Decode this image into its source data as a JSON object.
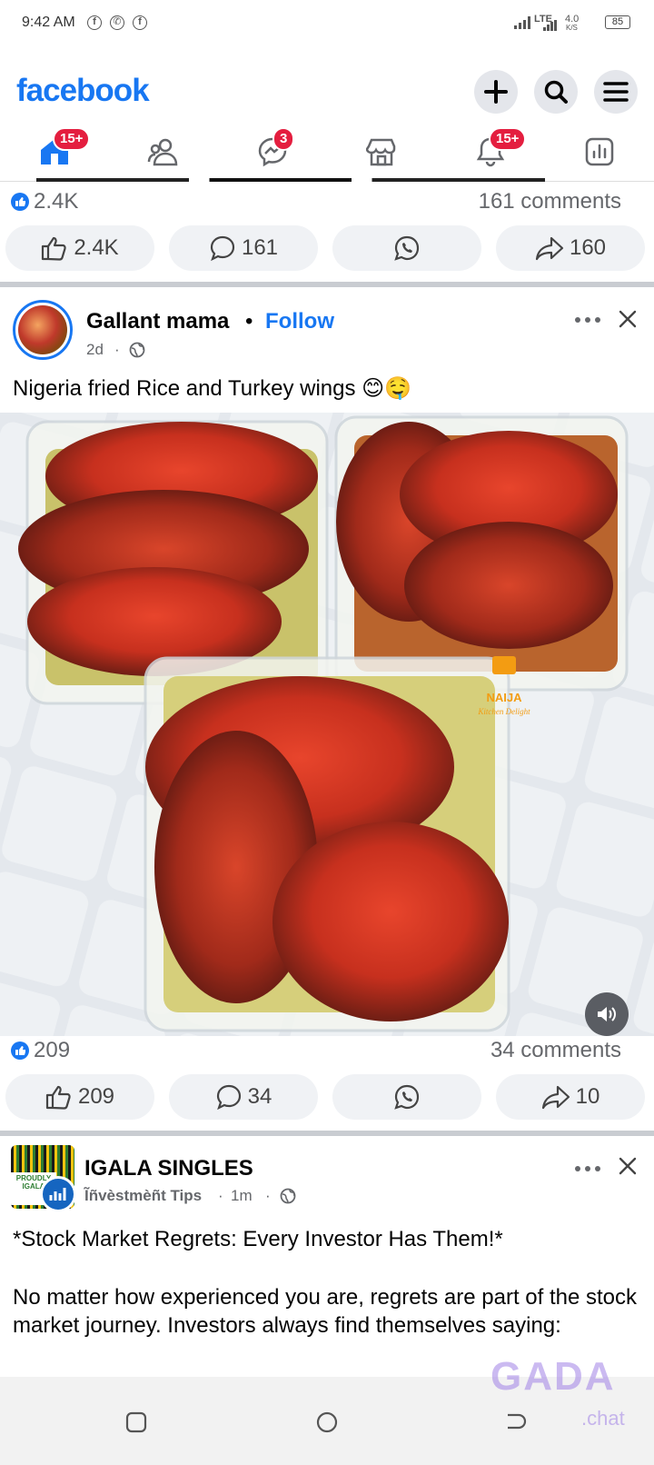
{
  "status_bar": {
    "time": "9:42 AM",
    "network": "LTE",
    "speed": "4.0",
    "speed_unit": "K/S",
    "battery": "85"
  },
  "header": {
    "logo": "facebook"
  },
  "nav": {
    "home_badge": "15+",
    "messenger_badge": "3",
    "notifications_badge": "15+"
  },
  "post1": {
    "likes": "2.4K",
    "comments": "161 comments",
    "like_btn": "2.4K",
    "comment_btn": "161",
    "share_btn": "160"
  },
  "post2": {
    "author": "Gallant mama",
    "follow": "Follow",
    "time": "2d",
    "text": "Nigeria fried Rice and Turkey wings 😊🤤",
    "watermark_brand": "NAIJA",
    "watermark_sub": "Kitchen Delight",
    "likes": "209",
    "comments": "34 comments",
    "like_btn": "209",
    "comment_btn": "34",
    "share_btn": "10"
  },
  "post3": {
    "author": "IGALA SINGLES",
    "subtitle": "Ĩñvèstmèñt Tips",
    "time": "1m",
    "avatar_text": "PROUDLY IGALA",
    "headline": "*Stock Market Regrets: Every Investor Has Them!*",
    "body": "No matter how experienced you are, regrets are part of the stock market journey. Investors always find themselves saying:"
  },
  "watermark": {
    "main": "GADA",
    "sub": ".chat"
  },
  "colors": {
    "brand": "#1877f2",
    "badge": "#e41e3f"
  }
}
